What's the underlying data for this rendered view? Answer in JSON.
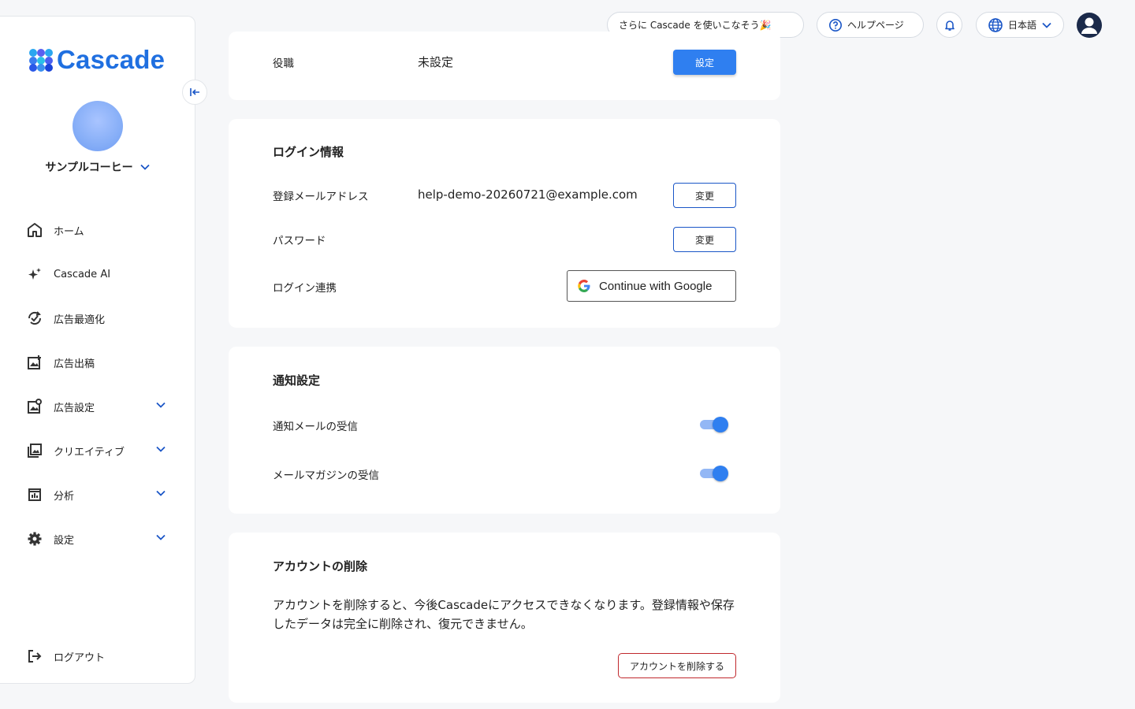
{
  "brand": {
    "name": "Cascade",
    "color": "#1f6fe0"
  },
  "sidebar": {
    "company": "サンプルコーヒー",
    "items": [
      {
        "label": "ホーム",
        "icon": "home-icon"
      },
      {
        "label": "Cascade AI",
        "icon": "sparkle-icon"
      },
      {
        "label": "広告最適化",
        "icon": "optimize-icon"
      },
      {
        "label": "広告出稿",
        "icon": "ad-publish-icon"
      },
      {
        "label": "広告設定",
        "icon": "ad-settings-icon",
        "expandable": true
      },
      {
        "label": "クリエイティブ",
        "icon": "image-gallery-icon",
        "expandable": true
      },
      {
        "label": "分析",
        "icon": "analytics-icon",
        "expandable": true
      },
      {
        "label": "設定",
        "icon": "gear-icon",
        "expandable": true
      }
    ],
    "logout": "ログアウト"
  },
  "header": {
    "promo": "さらに Cascade を使いこなそう🎉",
    "help": "ヘルプページ",
    "language": "日本語"
  },
  "profile": {
    "role_label": "役職",
    "role_value": "未設定",
    "role_button": "設定"
  },
  "login": {
    "title": "ログイン情報",
    "email_label": "登録メールアドレス",
    "email_value": "help-demo-20260721@example.com",
    "email_button": "変更",
    "password_label": "パスワード",
    "password_button": "変更",
    "link_label": "ログイン連携",
    "google_button": "Continue with Google"
  },
  "notifications": {
    "title": "通知設定",
    "mail_label": "通知メールの受信",
    "mail_on": true,
    "magazine_label": "メールマガジンの受信",
    "magazine_on": true
  },
  "delete": {
    "title": "アカウントの削除",
    "description": "アカウントを削除すると、今後Cascadeにアクセスできなくなります。登録情報や保存したデータは完全に削除され、復元できません。",
    "button": "アカウントを削除する"
  }
}
